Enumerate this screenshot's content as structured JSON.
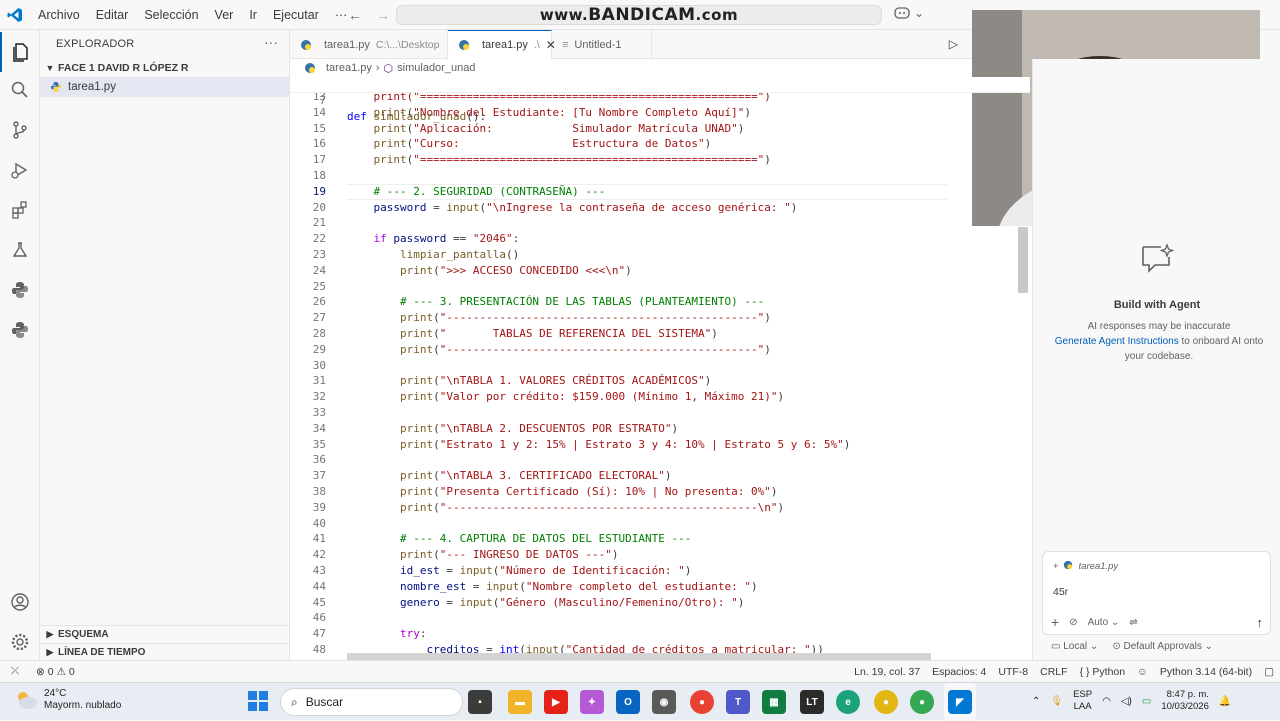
{
  "menu": [
    "Archivo",
    "Editar",
    "Selección",
    "Ver",
    "Ir",
    "Ejecutar"
  ],
  "menu_more": "···",
  "watermark": {
    "prefix": "www.",
    "brand": "BANDICAM",
    "suffix": ".com"
  },
  "explorer": {
    "title": "EXPLORADOR",
    "more": "···",
    "folder": "FACE 1 DAVID R LÓPEZ R",
    "file": "tarea1.py",
    "sections": [
      "ESQUEMA",
      "LÍNEA DE TIEMPO"
    ]
  },
  "tabs": [
    {
      "label": "tarea1.py",
      "desc": "C:\\...\\Desktop"
    },
    {
      "label": "tarea1.py",
      "desc": ".\\"
    },
    {
      "label": "Untitled-1",
      "desc": ""
    }
  ],
  "breadcrumb": {
    "file": "tarea1.py",
    "symbol": "simulador_unad"
  },
  "sticky": {
    "ln": "7",
    "text": "def simulador_unad():"
  },
  "code": [
    {
      "ln": "13",
      "t": [
        [
          "    print(\"===================================================\")",
          "s"
        ]
      ]
    },
    {
      "ln": "14",
      "t": [
        [
          "    ",
          ""
        ],
        [
          "print",
          "f"
        ],
        [
          "(",
          ""
        ],
        [
          "\"Nombre del Estudiante: [Tu Nombre Completo Aquí]\"",
          "s"
        ],
        [
          ")",
          ""
        ]
      ]
    },
    {
      "ln": "15",
      "t": [
        [
          "    ",
          ""
        ],
        [
          "print",
          "f"
        ],
        [
          "(",
          ""
        ],
        [
          "\"Aplicación:            Simulador Matrícula UNAD\"",
          "s"
        ],
        [
          ")",
          ""
        ]
      ]
    },
    {
      "ln": "16",
      "t": [
        [
          "    ",
          ""
        ],
        [
          "print",
          "f"
        ],
        [
          "(",
          ""
        ],
        [
          "\"Curso:                 Estructura de Datos\"",
          "s"
        ],
        [
          ")",
          ""
        ]
      ]
    },
    {
      "ln": "17",
      "t": [
        [
          "    ",
          ""
        ],
        [
          "print",
          "f"
        ],
        [
          "(",
          ""
        ],
        [
          "\"===================================================\"",
          "s"
        ],
        [
          ")",
          ""
        ]
      ]
    },
    {
      "ln": "18",
      "t": []
    },
    {
      "ln": "19",
      "cur": true,
      "t": [
        [
          "    ",
          ""
        ],
        [
          "# --- 2. SEGURIDAD (CONTRASEÑA) ---",
          "c"
        ]
      ]
    },
    {
      "ln": "20",
      "t": [
        [
          "    ",
          ""
        ],
        [
          "password",
          "v"
        ],
        [
          " = ",
          ""
        ],
        [
          "input",
          "f"
        ],
        [
          "(",
          ""
        ],
        [
          "\"\\nIngrese la contraseña de acceso genérica: \"",
          "s"
        ],
        [
          ")",
          ""
        ]
      ]
    },
    {
      "ln": "21",
      "t": []
    },
    {
      "ln": "22",
      "t": [
        [
          "    ",
          ""
        ],
        [
          "if",
          "ctl"
        ],
        [
          " ",
          ""
        ],
        [
          "password",
          "v"
        ],
        [
          " == ",
          ""
        ],
        [
          "\"2046\"",
          "s"
        ],
        [
          ":",
          ""
        ]
      ]
    },
    {
      "ln": "23",
      "t": [
        [
          "        ",
          ""
        ],
        [
          "limpiar_pantalla",
          "f"
        ],
        [
          "()",
          ""
        ]
      ]
    },
    {
      "ln": "24",
      "t": [
        [
          "        ",
          ""
        ],
        [
          "print",
          "f"
        ],
        [
          "(",
          ""
        ],
        [
          "\">>> ACCESO CONCEDIDO <<<\\n\"",
          "s"
        ],
        [
          ")",
          ""
        ]
      ]
    },
    {
      "ln": "25",
      "t": []
    },
    {
      "ln": "26",
      "t": [
        [
          "        ",
          ""
        ],
        [
          "# --- 3. PRESENTACIÓN DE LAS TABLAS (PLANTEAMIENTO) ---",
          "c"
        ]
      ]
    },
    {
      "ln": "27",
      "t": [
        [
          "        ",
          ""
        ],
        [
          "print",
          "f"
        ],
        [
          "(",
          ""
        ],
        [
          "\"-----------------------------------------------\"",
          "s"
        ],
        [
          ")",
          ""
        ]
      ]
    },
    {
      "ln": "28",
      "t": [
        [
          "        ",
          ""
        ],
        [
          "print",
          "f"
        ],
        [
          "(",
          ""
        ],
        [
          "\"       TABLAS DE REFERENCIA DEL SISTEMA\"",
          "s"
        ],
        [
          ")",
          ""
        ]
      ]
    },
    {
      "ln": "29",
      "t": [
        [
          "        ",
          ""
        ],
        [
          "print",
          "f"
        ],
        [
          "(",
          ""
        ],
        [
          "\"-----------------------------------------------\"",
          "s"
        ],
        [
          ")",
          ""
        ]
      ]
    },
    {
      "ln": "30",
      "t": []
    },
    {
      "ln": "31",
      "t": [
        [
          "        ",
          ""
        ],
        [
          "print",
          "f"
        ],
        [
          "(",
          ""
        ],
        [
          "\"\\nTABLA 1. VALORES CRÉDITOS ACADÉMICOS\"",
          "s"
        ],
        [
          ")",
          ""
        ]
      ]
    },
    {
      "ln": "32",
      "t": [
        [
          "        ",
          ""
        ],
        [
          "print",
          "f"
        ],
        [
          "(",
          ""
        ],
        [
          "\"Valor por crédito: $159.000 (Mínimo 1, Máximo 21)\"",
          "s"
        ],
        [
          ")",
          ""
        ]
      ]
    },
    {
      "ln": "33",
      "t": []
    },
    {
      "ln": "34",
      "t": [
        [
          "        ",
          ""
        ],
        [
          "print",
          "f"
        ],
        [
          "(",
          ""
        ],
        [
          "\"\\nTABLA 2. DESCUENTOS POR ESTRATO\"",
          "s"
        ],
        [
          ")",
          ""
        ]
      ]
    },
    {
      "ln": "35",
      "t": [
        [
          "        ",
          ""
        ],
        [
          "print",
          "f"
        ],
        [
          "(",
          ""
        ],
        [
          "\"Estrato 1 y 2: 15% | Estrato 3 y 4: 10% | Estrato 5 y 6: 5%\"",
          "s"
        ],
        [
          ")",
          ""
        ]
      ]
    },
    {
      "ln": "36",
      "t": []
    },
    {
      "ln": "37",
      "t": [
        [
          "        ",
          ""
        ],
        [
          "print",
          "f"
        ],
        [
          "(",
          ""
        ],
        [
          "\"\\nTABLA 3. CERTIFICADO ELECTORAL\"",
          "s"
        ],
        [
          ")",
          ""
        ]
      ]
    },
    {
      "ln": "38",
      "t": [
        [
          "        ",
          ""
        ],
        [
          "print",
          "f"
        ],
        [
          "(",
          ""
        ],
        [
          "\"Presenta Certificado (Sí): 10% | No presenta: 0%\"",
          "s"
        ],
        [
          ")",
          ""
        ]
      ]
    },
    {
      "ln": "39",
      "t": [
        [
          "        ",
          ""
        ],
        [
          "print",
          "f"
        ],
        [
          "(",
          ""
        ],
        [
          "\"-----------------------------------------------\\n\"",
          "s"
        ],
        [
          ")",
          ""
        ]
      ]
    },
    {
      "ln": "40",
      "t": []
    },
    {
      "ln": "41",
      "t": [
        [
          "        ",
          ""
        ],
        [
          "# --- 4. CAPTURA DE DATOS DEL ESTUDIANTE ---",
          "c"
        ]
      ]
    },
    {
      "ln": "42",
      "t": [
        [
          "        ",
          ""
        ],
        [
          "print",
          "f"
        ],
        [
          "(",
          ""
        ],
        [
          "\"--- INGRESO DE DATOS ---\"",
          "s"
        ],
        [
          ")",
          ""
        ]
      ]
    },
    {
      "ln": "43",
      "t": [
        [
          "        ",
          ""
        ],
        [
          "id_est",
          "v"
        ],
        [
          " = ",
          ""
        ],
        [
          "input",
          "f"
        ],
        [
          "(",
          ""
        ],
        [
          "\"Número de Identificación: \"",
          "s"
        ],
        [
          ")",
          ""
        ]
      ]
    },
    {
      "ln": "44",
      "t": [
        [
          "        ",
          ""
        ],
        [
          "nombre_est",
          "v"
        ],
        [
          " = ",
          ""
        ],
        [
          "input",
          "f"
        ],
        [
          "(",
          ""
        ],
        [
          "\"Nombre completo del estudiante: \"",
          "s"
        ],
        [
          ")",
          ""
        ]
      ]
    },
    {
      "ln": "45",
      "t": [
        [
          "        ",
          ""
        ],
        [
          "genero",
          "v"
        ],
        [
          " = ",
          ""
        ],
        [
          "input",
          "f"
        ],
        [
          "(",
          ""
        ],
        [
          "\"Género (Masculino/Femenino/Otro): \"",
          "s"
        ],
        [
          ")",
          ""
        ]
      ]
    },
    {
      "ln": "46",
      "t": []
    },
    {
      "ln": "47",
      "t": [
        [
          "        ",
          ""
        ],
        [
          "try",
          "ctl"
        ],
        [
          ":",
          ""
        ]
      ]
    },
    {
      "ln": "48",
      "t": [
        [
          "            ",
          ""
        ],
        [
          "creditos",
          "v"
        ],
        [
          " = ",
          ""
        ],
        [
          "int",
          "k"
        ],
        [
          "(",
          ""
        ],
        [
          "input",
          "f"
        ],
        [
          "(",
          ""
        ],
        [
          "\"Cantidad de créditos a matricular: \"",
          "s"
        ],
        [
          "))",
          ""
        ]
      ]
    }
  ],
  "agent": {
    "title": "Build with Agent",
    "desc1": "AI responses may be inaccurate",
    "link": "Generate Agent Instructions",
    "desc2": " to onboard AI onto your codebase.",
    "context": "tarea1.py",
    "input": "45r",
    "mode": "Auto",
    "local": "Local",
    "approvals": "Default Approvals"
  },
  "status": {
    "errors": "0",
    "warnings": "0",
    "position": "Ln. 19, col. 37",
    "spaces": "Espacios: 4",
    "encoding": "UTF-8",
    "eol": "CRLF",
    "language": "Python",
    "interpreter": "Python 3.14 (64-bit)"
  },
  "taskbar": {
    "temp": "24°C",
    "weather": "Mayorm. nublado",
    "search": "Buscar",
    "lang1": "ESP",
    "lang2": "LAA",
    "time": "8:47 p. m.",
    "date": "10/03/2026"
  },
  "colors": {
    "accent": "#005fb8",
    "python_blue": "#3572a5",
    "python_yellow": "#ffd43b"
  }
}
